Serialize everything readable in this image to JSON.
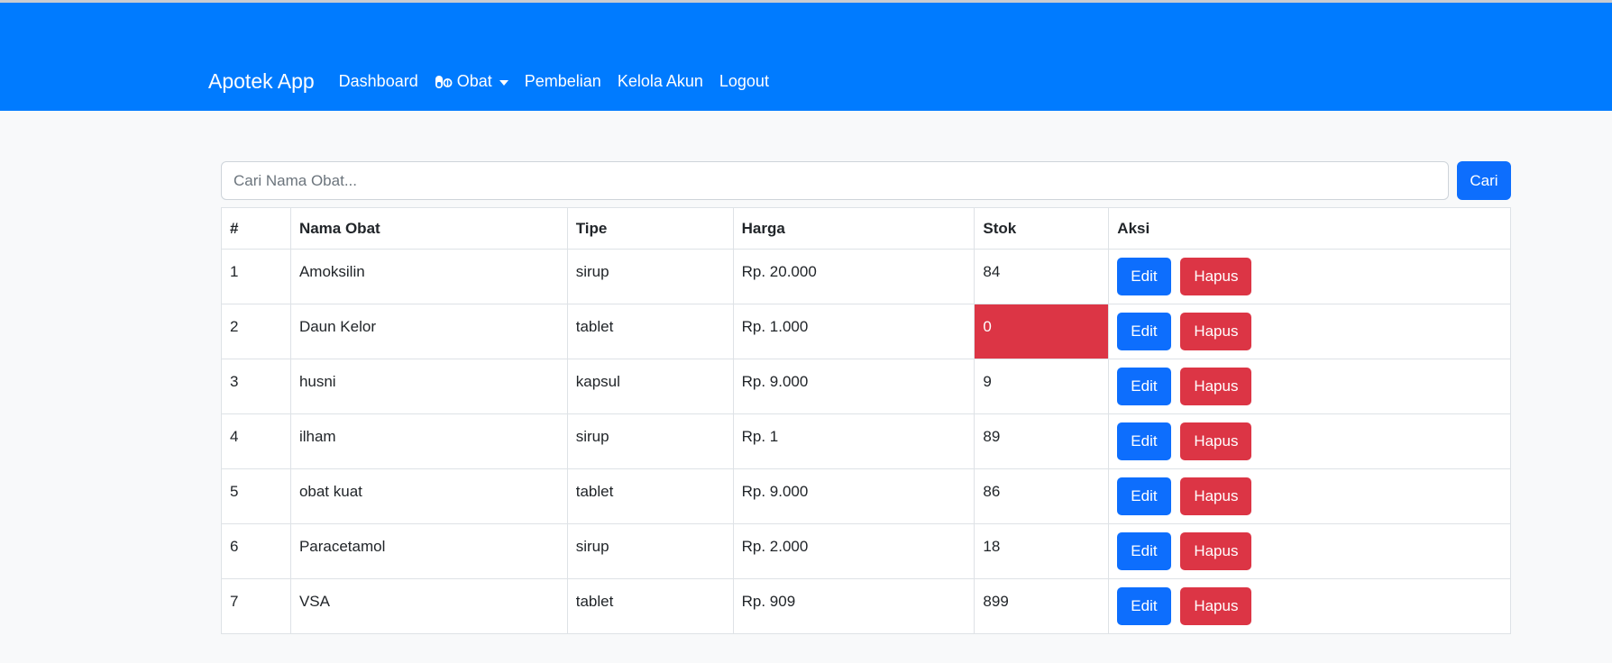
{
  "navbar": {
    "brand": "Apotek App",
    "links": {
      "dashboard": "Dashboard",
      "obat": "Obat",
      "pembelian": "Pembelian",
      "kelola_akun": "Kelola Akun",
      "logout": "Logout"
    },
    "obat_icon": "pills-icon"
  },
  "search": {
    "placeholder": "Cari Nama Obat...",
    "value": "",
    "button": "Cari"
  },
  "table": {
    "headers": [
      "#",
      "Nama Obat",
      "Tipe",
      "Harga",
      "Stok",
      "Aksi"
    ],
    "rows": [
      {
        "no": "1",
        "nama": "Amoksilin",
        "tipe": "sirup",
        "harga": "Rp. 20.000",
        "stok": "84"
      },
      {
        "no": "2",
        "nama": "Daun Kelor",
        "tipe": "tablet",
        "harga": "Rp. 1.000",
        "stok": "0"
      },
      {
        "no": "3",
        "nama": "husni",
        "tipe": "kapsul",
        "harga": "Rp. 9.000",
        "stok": "9"
      },
      {
        "no": "4",
        "nama": "ilham",
        "tipe": "sirup",
        "harga": "Rp. 1",
        "stok": "89"
      },
      {
        "no": "5",
        "nama": "obat kuat",
        "tipe": "tablet",
        "harga": "Rp. 9.000",
        "stok": "86"
      },
      {
        "no": "6",
        "nama": "Paracetamol",
        "tipe": "sirup",
        "harga": "Rp. 2.000",
        "stok": "18"
      },
      {
        "no": "7",
        "nama": "VSA",
        "tipe": "tablet",
        "harga": "Rp. 909",
        "stok": "899"
      }
    ],
    "edit_label": "Edit",
    "hapus_label": "Hapus"
  },
  "colors": {
    "navbar": "#007bff",
    "primary": "#0d6efd",
    "danger": "#dc3545"
  }
}
